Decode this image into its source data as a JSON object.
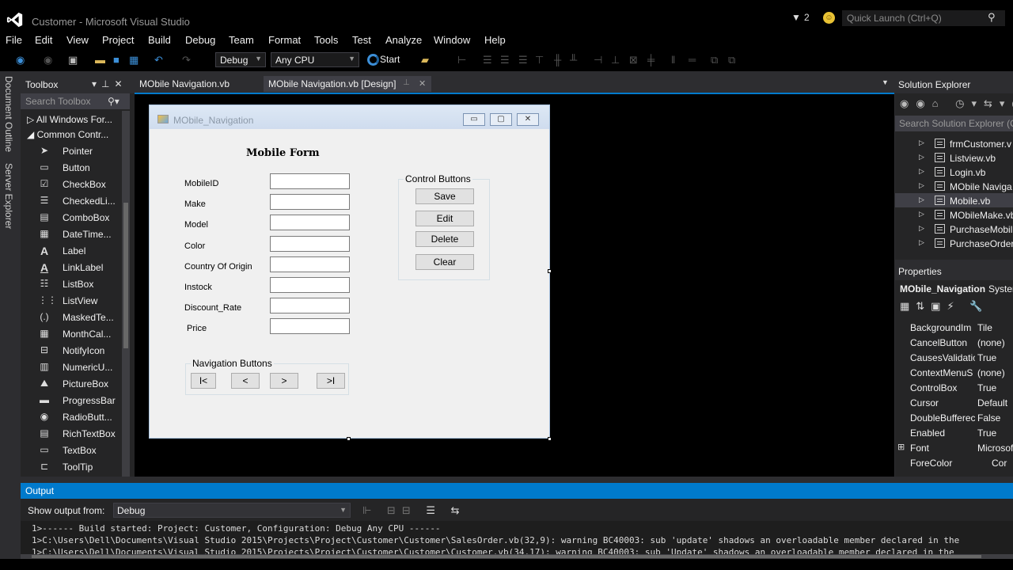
{
  "window": {
    "title": "Customer - Microsoft Visual Studio",
    "notification_count": "2",
    "quick_launch_placeholder": "Quick Launch (Ctrl+Q)"
  },
  "menu": [
    "File",
    "Edit",
    "View",
    "Project",
    "Build",
    "Debug",
    "Team",
    "Format",
    "Tools",
    "Test",
    "Analyze",
    "Window",
    "Help"
  ],
  "toolbar": {
    "configuration": "Debug",
    "platform": "Any CPU",
    "start_label": "Start"
  },
  "side_tabs": [
    "Document Outline",
    "Server Explorer"
  ],
  "toolbox": {
    "title": "Toolbox",
    "search_placeholder": "Search Toolbox",
    "groups": [
      "All Windows For...",
      "Common Contr..."
    ],
    "tools": [
      {
        "label": "Pointer",
        "icon": "pointer-icon"
      },
      {
        "label": "Button",
        "icon": "button-icon"
      },
      {
        "label": "CheckBox",
        "icon": "checkbox-icon"
      },
      {
        "label": "CheckedLi...",
        "icon": "checkedlistbox-icon"
      },
      {
        "label": "ComboBox",
        "icon": "combobox-icon"
      },
      {
        "label": "DateTime...",
        "icon": "datetimepicker-icon"
      },
      {
        "label": "Label",
        "icon": "label-icon"
      },
      {
        "label": "LinkLabel",
        "icon": "linklabel-icon"
      },
      {
        "label": "ListBox",
        "icon": "listbox-icon"
      },
      {
        "label": "ListView",
        "icon": "listview-icon"
      },
      {
        "label": "MaskedTe...",
        "icon": "maskedtextbox-icon"
      },
      {
        "label": "MonthCal...",
        "icon": "monthcalendar-icon"
      },
      {
        "label": "NotifyIcon",
        "icon": "notifyicon-icon"
      },
      {
        "label": "NumericU...",
        "icon": "numericupdown-icon"
      },
      {
        "label": "PictureBox",
        "icon": "picturebox-icon"
      },
      {
        "label": "ProgressBar",
        "icon": "progressbar-icon"
      },
      {
        "label": "RadioButt...",
        "icon": "radiobutton-icon"
      },
      {
        "label": "RichTextBox",
        "icon": "richtextbox-icon"
      },
      {
        "label": "TextBox",
        "icon": "textbox-icon"
      },
      {
        "label": "ToolTip",
        "icon": "tooltip-icon"
      }
    ]
  },
  "doc_tabs": [
    "MObile Navigation.vb",
    "MObile Navigation.vb [Design]"
  ],
  "form": {
    "title": "MObile_Navigation",
    "heading": "Mobile Form",
    "fields": [
      "MobileID",
      "Make",
      "Model",
      "Color",
      "Country Of Origin",
      "Instock",
      "Discount_Rate",
      "Price"
    ],
    "control_group_title": "Control Buttons",
    "control_buttons": [
      "Save",
      "Edit",
      "Delete",
      "Clear"
    ],
    "nav_group_title": "Navigation Buttons",
    "nav_buttons": [
      "I<",
      "<",
      ">",
      ">I"
    ]
  },
  "solution_explorer": {
    "title": "Solution Explorer",
    "search_placeholder": "Search Solution Explorer (C",
    "items": [
      "frmCustomer.v",
      "Listview.vb",
      "Login.vb",
      "MObile Naviga",
      "Mobile.vb",
      "MObileMake.vb",
      "PurchaseMobil",
      "PurchaseOrder"
    ],
    "selected_index": 4
  },
  "properties": {
    "title": "Properties",
    "object_name": "MObile_Navigation",
    "object_type": "Syster",
    "rows": [
      {
        "name": "BackgroundIm",
        "value": "Tile",
        "expand": ""
      },
      {
        "name": "CancelButton",
        "value": "(none)",
        "expand": ""
      },
      {
        "name": "CausesValidatic",
        "value": "True",
        "expand": ""
      },
      {
        "name": "ContextMenuS",
        "value": "(none)",
        "expand": ""
      },
      {
        "name": "ControlBox",
        "value": "True",
        "expand": ""
      },
      {
        "name": "Cursor",
        "value": "Default",
        "expand": ""
      },
      {
        "name": "DoubleBufferec",
        "value": "False",
        "expand": ""
      },
      {
        "name": "Enabled",
        "value": "True",
        "expand": ""
      },
      {
        "name": "Font",
        "value": "Microsof",
        "expand": "⊞"
      },
      {
        "name": "ForeColor",
        "value": "Cor",
        "expand": ""
      }
    ]
  },
  "output": {
    "title": "Output",
    "show_from_label": "Show output from:",
    "source": "Debug",
    "lines": [
      "1>------ Build started: Project: Customer, Configuration: Debug Any CPU ------",
      "1>C:\\Users\\Dell\\Documents\\Visual Studio 2015\\Projects\\Project\\Customer\\Customer\\SalesOrder.vb(32,9): warning BC40003: sub 'update' shadows an overloadable member declared in the",
      "1>C:\\Users\\Dell\\Documents\\Visual Studio 2015\\Projects\\Project\\Customer\\Customer\\Customer.vb(34,17): warning BC40003: sub 'Update' shadows an overloadable member declared in the"
    ]
  },
  "colors": {
    "accent": "#007acc",
    "background": "#2d2d30",
    "designer_bg": "#000000",
    "form_bg": "#f0f0f0"
  }
}
